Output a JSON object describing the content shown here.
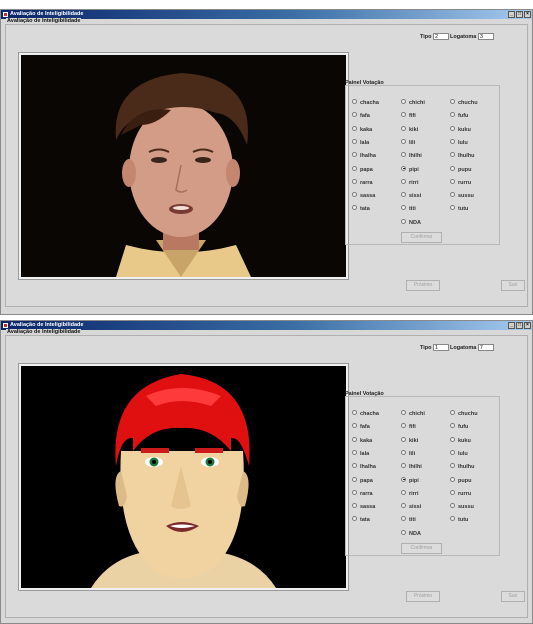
{
  "windows": [
    {
      "title": "Avaliação de Inteligibilidade",
      "panel_title": "Avaliação de Inteligibilidade",
      "tipo_label": "Tipo",
      "tipo_value": "2",
      "logatoma_label": "Logatoma",
      "logatoma_value": "3",
      "video_kind": "real person",
      "vote_panel_title": "Painel Votação",
      "options": [
        "chacha",
        "chichi",
        "chuchu",
        "fafa",
        "fifi",
        "fufu",
        "kaka",
        "kiki",
        "kuku",
        "lala",
        "lili",
        "lulu",
        "lhalha",
        "lhilhi",
        "lhulhu",
        "papa",
        "pipi",
        "pupu",
        "rarra",
        "rirri",
        "rurru",
        "sassa",
        "sissi",
        "sussu",
        "tata",
        "titi",
        "tutu",
        "NDA"
      ],
      "selected": "pipi",
      "confirm_label": "Confirmar",
      "next_label": "Próximo",
      "exit_label": "Sair"
    },
    {
      "title": "Avaliação de Inteligibilidade",
      "panel_title": "Avaliação de Inteligibilidade",
      "tipo_label": "Tipo",
      "tipo_value": "1",
      "logatoma_label": "Logatoma",
      "logatoma_value": "7",
      "video_kind": "3D avatar",
      "vote_panel_title": "Painel Votação",
      "options": [
        "chacha",
        "chichi",
        "chuchu",
        "fafa",
        "fifi",
        "fufu",
        "kaka",
        "kiki",
        "kuku",
        "lala",
        "lili",
        "lulu",
        "lhalha",
        "lhilhi",
        "lhulhu",
        "papa",
        "pipi",
        "pupu",
        "rarra",
        "rirri",
        "rurru",
        "sassa",
        "sissi",
        "sussu",
        "tata",
        "titi",
        "tutu",
        "NDA"
      ],
      "selected": "pipi",
      "confirm_label": "Confirmar",
      "next_label": "Próximo",
      "exit_label": "Sair"
    }
  ],
  "colors": {
    "titlebar": "#0a246a",
    "avatar_hair": "#e01010",
    "avatar_skin": "#f0d3a0",
    "real_hair": "#4a2a18",
    "real_skin": "#d8a088"
  }
}
